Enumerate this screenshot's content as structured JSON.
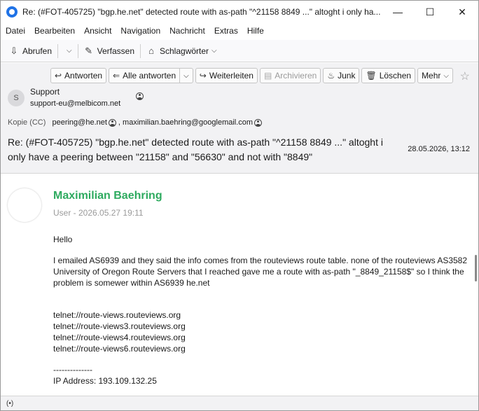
{
  "window": {
    "title": "Re: (#FOT-405725) \"bgp.he.net\" detected route with as-path \"^21158 8849 ...\" altoght i only ha...",
    "minimize": "—",
    "maximize": "☐",
    "close": "✕"
  },
  "menu": [
    "Datei",
    "Bearbeiten",
    "Ansicht",
    "Navigation",
    "Nachricht",
    "Extras",
    "Hilfe"
  ],
  "toolbar": {
    "fetch_label": "Abrufen",
    "compose_label": "Verfassen",
    "tags_label": "Schlagwörter"
  },
  "header_actions": {
    "reply": "Antworten",
    "reply_all": "Alle antworten",
    "forward": "Weiterleiten",
    "archive": "Archivieren",
    "junk": "Junk",
    "delete": "Löschen",
    "more": "Mehr"
  },
  "message": {
    "sender_initial": "S",
    "sender_name": "Support",
    "sender_email": "support-eu@melbicom.net",
    "cc_label": "Kopie (CC)",
    "cc": [
      "peering@he.net",
      "maximilian.baehring@googlemail.com"
    ],
    "subject": "Re: (#FOT-405725) \"bgp.he.net\" detected route with as-path \"^21158 8849 ...\" altoght i only have a peering between \"21158\" and \"56630\" and not with \"8849\"",
    "date": "28.05.2026, 13:12"
  },
  "body": {
    "author": "Maximilian Baehring",
    "meta": "User - 2026.05.27 19:11",
    "greeting": "Hello",
    "paragraph": "I emailed AS6939 and they said the info comes from the routeviews route table. none of the routeviews AS3582 University of Oregon Route Servers that I reached gave me a route with as-path \"_8849_21158$\" so I think the problem is somewer within AS6939 he.net",
    "links": [
      "telnet://route-views.routeviews.org",
      "telnet://route-views3.routeviews.org",
      "telnet://route-views4.routeviews.org",
      "telnet://route-views6.routeviews.org"
    ],
    "separator": "--------------",
    "ip_line": "IP Address: 193.109.132.25"
  },
  "status": {
    "icon": "(•)"
  }
}
